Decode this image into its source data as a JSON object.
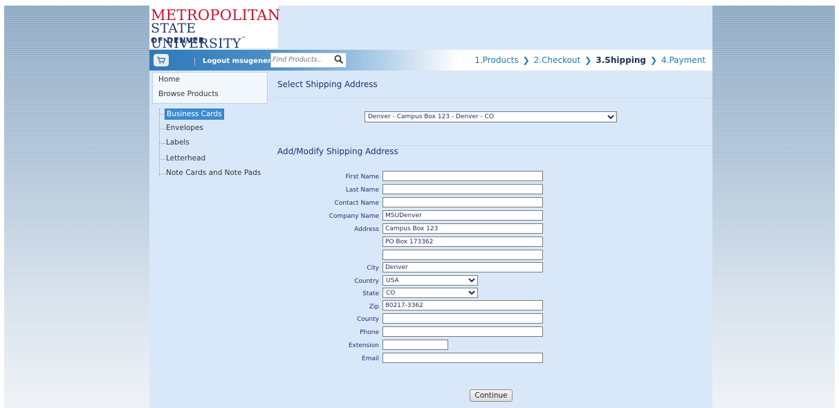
{
  "logo": {
    "line1": "METROPOLITAN",
    "line2": "STATE UNIVERSITY",
    "tm": "™",
    "line3": "OF DENVER"
  },
  "nav": {
    "logout_label": "Logout msugeneric",
    "search_placeholder": "Find Products..",
    "steps": [
      {
        "label": "1.Products"
      },
      {
        "label": "2.Checkout"
      },
      {
        "label": "3.Shipping"
      },
      {
        "label": "4.Payment"
      }
    ]
  },
  "sidebar": {
    "links": [
      {
        "label": "Home"
      },
      {
        "label": "Browse Products"
      }
    ],
    "categories": [
      {
        "label": "Business Cards"
      },
      {
        "label": "Envelopes"
      },
      {
        "label": "Labels"
      },
      {
        "label": "Letterhead"
      },
      {
        "label": "Note Cards and Note Pads"
      }
    ]
  },
  "shipping": {
    "select_title": "Select Shipping Address",
    "selected_address": "Denver - Campus Box 123 - Denver - CO",
    "form_title": "Add/Modify Shipping Address",
    "fields": {
      "first_name": {
        "label": "First Name",
        "value": ""
      },
      "last_name": {
        "label": "Last Name",
        "value": ""
      },
      "contact_name": {
        "label": "Contact Name",
        "value": ""
      },
      "company_name": {
        "label": "Company Name",
        "value": "MSUDenver"
      },
      "address": {
        "label": "Address",
        "value1": "Campus Box 123",
        "value2": "PO Box 173362",
        "value3": ""
      },
      "city": {
        "label": "City",
        "value": "Denver"
      },
      "country": {
        "label": "Country",
        "value": "USA"
      },
      "state": {
        "label": "State",
        "value": "CO"
      },
      "zip": {
        "label": "Zip",
        "value": "80217-3362"
      },
      "county": {
        "label": "County",
        "value": ""
      },
      "phone": {
        "label": "Phone",
        "value": ""
      },
      "extension": {
        "label": "Extension",
        "value": ""
      },
      "email": {
        "label": "Email",
        "value": ""
      }
    },
    "continue_label": "Continue"
  },
  "colors": {
    "accent": "#1e78b4",
    "title": "#1d2f6e",
    "page_bg": "#d9e8f8",
    "selected_category": "#3a8dd4",
    "logo_red": "#c8102e"
  }
}
